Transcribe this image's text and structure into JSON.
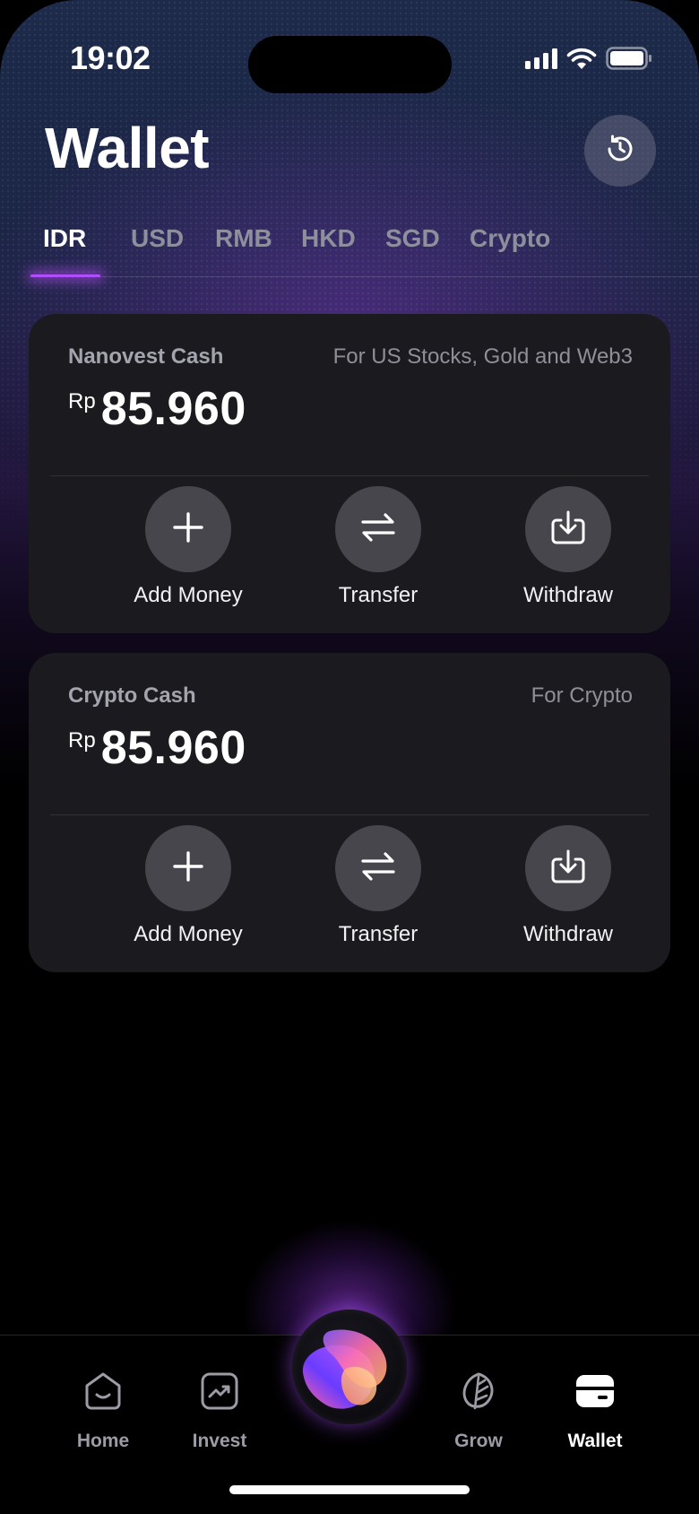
{
  "status_bar": {
    "time": "19:02"
  },
  "header": {
    "title": "Wallet",
    "history_icon": "history-clock-icon"
  },
  "tabs": [
    {
      "label": "IDR",
      "active": true
    },
    {
      "label": "USD",
      "active": false
    },
    {
      "label": "RMB",
      "active": false
    },
    {
      "label": "HKD",
      "active": false
    },
    {
      "label": "SGD",
      "active": false
    },
    {
      "label": "Crypto",
      "active": false
    }
  ],
  "cards": [
    {
      "name": "Nanovest Cash",
      "subtitle": "For US Stocks, Gold and Web3",
      "currency": "Rp",
      "amount": "85.960",
      "actions": [
        {
          "label": "Add Money",
          "icon": "plus-icon"
        },
        {
          "label": "Transfer",
          "icon": "transfer-arrows-icon"
        },
        {
          "label": "Withdraw",
          "icon": "withdraw-icon"
        }
      ]
    },
    {
      "name": "Crypto Cash",
      "subtitle": "For Crypto",
      "currency": "Rp",
      "amount": "85.960",
      "actions": [
        {
          "label": "Add Money",
          "icon": "plus-icon"
        },
        {
          "label": "Transfer",
          "icon": "transfer-arrows-icon"
        },
        {
          "label": "Withdraw",
          "icon": "withdraw-icon"
        }
      ]
    }
  ],
  "bottom_nav": [
    {
      "label": "Home",
      "icon": "home-icon",
      "active": false
    },
    {
      "label": "Invest",
      "icon": "invest-chart-icon",
      "active": false
    },
    {
      "label": "Grow",
      "icon": "leaf-icon",
      "active": false
    },
    {
      "label": "Wallet",
      "icon": "wallet-card-icon",
      "active": true
    }
  ],
  "colors": {
    "accent": "#b14cff",
    "card_bg": "#1b1b1f",
    "action_circle": "#46464c"
  }
}
